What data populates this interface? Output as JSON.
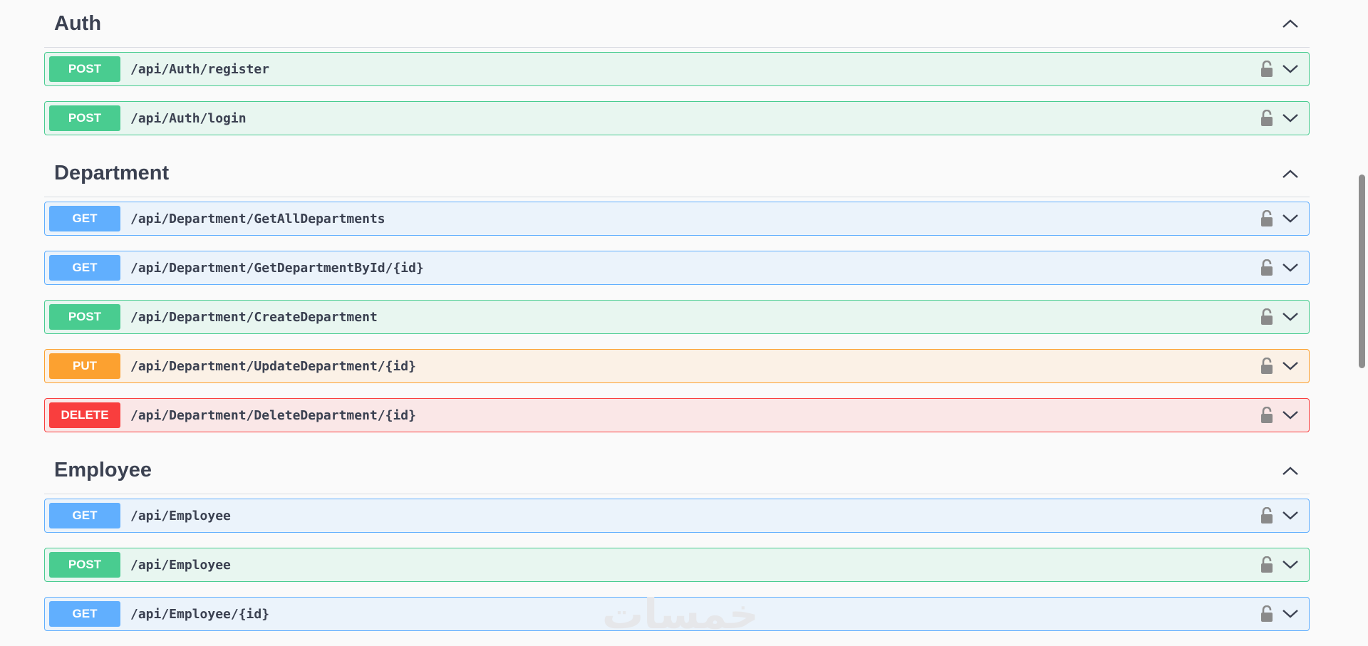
{
  "sections": [
    {
      "title": "Auth",
      "ops": [
        {
          "method": "POST",
          "path": "/api/Auth/register"
        },
        {
          "method": "POST",
          "path": "/api/Auth/login"
        }
      ]
    },
    {
      "title": "Department",
      "ops": [
        {
          "method": "GET",
          "path": "/api/Department/GetAllDepartments"
        },
        {
          "method": "GET",
          "path": "/api/Department/GetDepartmentById/{id}"
        },
        {
          "method": "POST",
          "path": "/api/Department/CreateDepartment"
        },
        {
          "method": "PUT",
          "path": "/api/Department/UpdateDepartment/{id}"
        },
        {
          "method": "DELETE",
          "path": "/api/Department/DeleteDepartment/{id}"
        }
      ]
    },
    {
      "title": "Employee",
      "ops": [
        {
          "method": "GET",
          "path": "/api/Employee"
        },
        {
          "method": "POST",
          "path": "/api/Employee"
        },
        {
          "method": "GET",
          "path": "/api/Employee/{id}"
        }
      ]
    }
  ],
  "watermark": "خمسات",
  "colors": {
    "get": "#61affe",
    "post": "#49cc90",
    "put": "#fca130",
    "delete": "#f93e3e",
    "text": "#3b4151"
  },
  "icons": {
    "collapse": "chevron-up-icon",
    "expand": "chevron-down-icon",
    "auth": "lock-icon"
  }
}
